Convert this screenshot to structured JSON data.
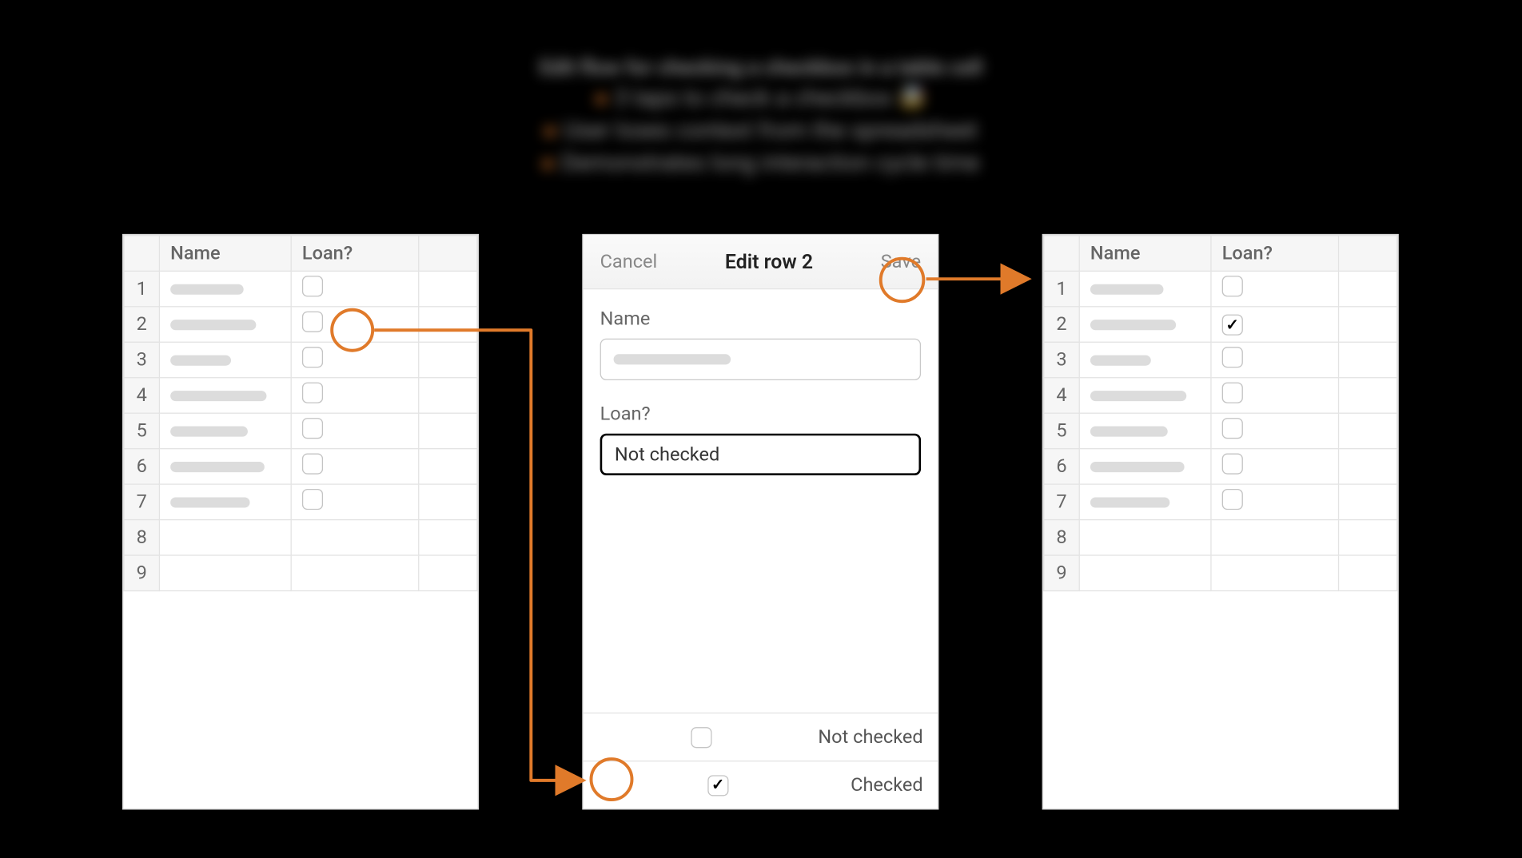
{
  "accent": "#e07a2a",
  "bullets": {
    "title": "Edit flow for checking a checkbox in a table cell",
    "items": [
      "3 taps to check a checkbox 🤯",
      "User loses context from the spreadsheet",
      "Demonstrates long interaction cycle time"
    ]
  },
  "table": {
    "headers": {
      "row": "",
      "name": "Name",
      "loan": "Loan?",
      "extra": ""
    },
    "rows": [
      1,
      2,
      3,
      4,
      5,
      6,
      7,
      8,
      9
    ],
    "name_bar_widths": [
      70,
      82,
      58,
      92,
      74,
      90,
      76
    ],
    "checked_row_after": 2
  },
  "modal": {
    "cancel": "Cancel",
    "title": "Edit row 2",
    "save": "Save",
    "name_label": "Name",
    "loan_label": "Loan?",
    "loan_value": "Not checked",
    "option_unchecked": "Not checked",
    "option_checked": "Checked"
  }
}
